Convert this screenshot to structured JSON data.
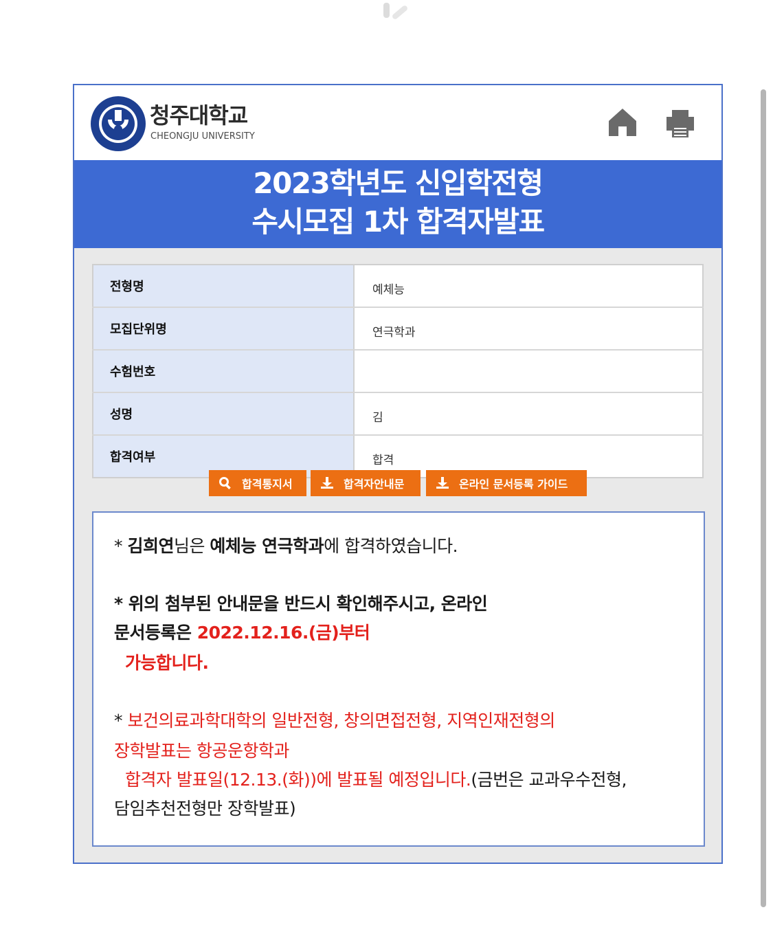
{
  "header": {
    "logo_kr": "청주대학교",
    "logo_en": "CHEONGJU UNIVERSITY",
    "home_icon": "home-icon",
    "print_icon": "print-icon"
  },
  "title": {
    "line1": "2023학년도 신입학전형",
    "line2": "수시모집 1차 합격자발표"
  },
  "rows": [
    {
      "label": "전형명",
      "value": "예체능"
    },
    {
      "label": "모집단위명",
      "value": "연극학과"
    },
    {
      "label": "수험번호",
      "value": ""
    },
    {
      "label": "성명",
      "value": "김"
    },
    {
      "label": "합격여부",
      "value": "합격"
    }
  ],
  "buttons": [
    {
      "label": "합격통지서",
      "icon": "search-icon"
    },
    {
      "label": "합격자안내문",
      "icon": "download-icon"
    },
    {
      "label": "온라인 문서등록 가이드",
      "icon": "download-icon"
    }
  ],
  "message": {
    "p1": {
      "prefix": "* ",
      "name": "김희연",
      "mid": "님은 ",
      "dept": "예체능 연극학과",
      "suffix": "에 합격하였습니다."
    },
    "p2": {
      "line1": "* 위의 첨부된 안내문을 반드시 확인해주시고, 온라인",
      "line2_prefix": "문서등록은 ",
      "line2_date": "2022.12.16.(금)부터",
      "line3": "가능합니다."
    },
    "p3": {
      "star": "* ",
      "line1": "보건의료과학대학의 일반전형, 창의면접전형, 지역인재전형의",
      "line2": "장학발표는 항공운항학과",
      "line3_red": "합격자 발표일(12.13.(화))에 발표될 예정입니다.",
      "line3_black": "(금번은 교과우수전형,",
      "line4": "담임추천전형만 장학발표)"
    }
  },
  "colors": {
    "accent_blue": "#3d6ad3",
    "button_orange": "#ec6f13",
    "label_bg": "#dfe7f7",
    "highlight_red": "#e3211c"
  }
}
